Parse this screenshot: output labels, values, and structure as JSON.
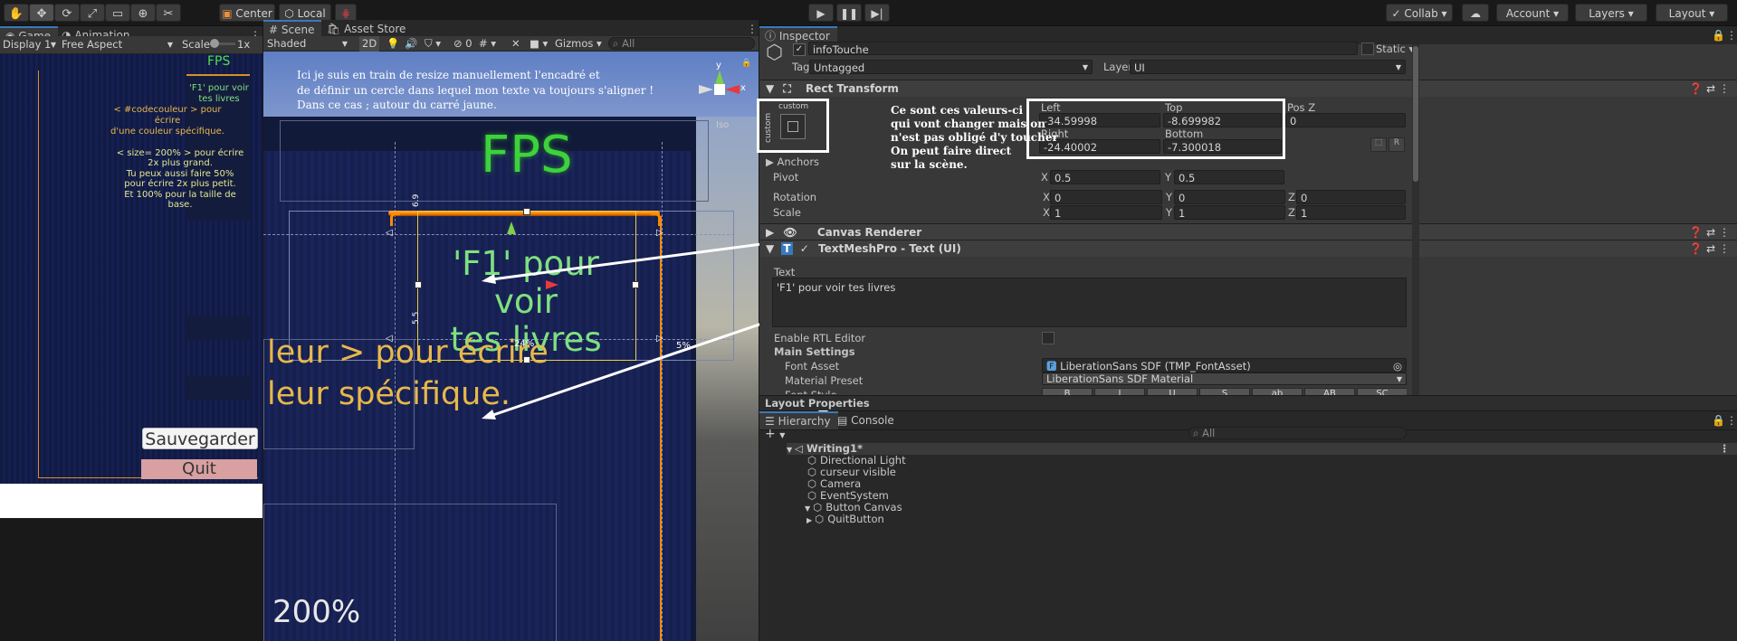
{
  "toolbar": {
    "tools": [
      "hand-tool",
      "move-tool",
      "rotate-tool",
      "scale-tool",
      "rect-tool",
      "transform-tool",
      "custom-tool"
    ],
    "pivot_label": "Center",
    "space_label": "Local",
    "collab_label": "Collab",
    "account_label": "Account",
    "layers_label": "Layers",
    "layout_label": "Layout"
  },
  "game_panel": {
    "tabs": [
      "Game",
      "Animation"
    ],
    "display": "Display 1",
    "aspect": "Free Aspect",
    "scale_label": "Scale",
    "scale_value": "1x",
    "fps": "FPS",
    "f1_text_l1": "'F1' pour voir",
    "f1_text_l2": "tes livres",
    "codecolor_l1": "< #codecouleur > pour écrire",
    "codecolor_l2": "d'une couleur spécifique.",
    "size_l1": "< size= 200% > pour écrire",
    "size_l2": "2x plus grand.",
    "size_l3": "Tu peux aussi faire 50%",
    "size_l4": "pour écrire 2x plus petit.",
    "size_l5": "Et 100% pour la taille de",
    "size_l6": "base.",
    "save_button": "Sauvegarder",
    "quit_button": "Quit"
  },
  "scene_panel": {
    "tabs": [
      "Scene",
      "Asset Store"
    ],
    "shading": "Shaded",
    "mode_2d": "2D",
    "hidden_count": "0",
    "gizmos": "Gizmos",
    "search_placeholder": "All",
    "annotation_l1": "Ici je suis en train de resize manuellement l'encadré et",
    "annotation_l2": "de définir un cercle dans lequel mon texte va toujours s'aligner !",
    "annotation_l3": "Dans ce cas ; autour du carré jaune.",
    "fps_big": "FPS",
    "f1_big_l1": "'F1' pour voir",
    "f1_big_l2": "tes livres",
    "orange_l1": "leur > pour écrire",
    "orange_l2": "leur spécifique.",
    "bottom_text": "200%",
    "pct_24": "24%",
    "pct_5": "5%",
    "pct_69": "6.9",
    "pct_55": "5.5",
    "iso": "Iso",
    "gizmo_y": "y",
    "gizmo_x": "x"
  },
  "inspector": {
    "tab": "Inspector",
    "object_name": "infoTouche",
    "static_label": "Static",
    "tag_label": "Tag",
    "tag_value": "Untagged",
    "layer_label": "Layer",
    "layer_value": "UI",
    "rect_transform": "Rect Transform",
    "anchor_preset": "custom",
    "anchor_side": "custom",
    "left_label": "Left",
    "left_value": "-34.59998",
    "top_label": "Top",
    "top_value": "-8.699982",
    "posz_label": "Pos Z",
    "posz_value": "0",
    "right_label": "Right",
    "right_value": "-24.40002",
    "bottom_label": "Bottom",
    "bottom_value": "-7.300018",
    "anchors_label": "Anchors",
    "pivot_label": "Pivot",
    "pivot_x": "0.5",
    "pivot_y": "0.5",
    "rotation_label": "Rotation",
    "rot_x": "0",
    "rot_y": "0",
    "rot_z": "0",
    "scale_label": "Scale",
    "scale_x": "1",
    "scale_y": "1",
    "scale_z": "1",
    "canvas_renderer": "Canvas Renderer",
    "tmp_text": "TextMeshPro - Text (UI)",
    "text_label": "Text",
    "text_value": "'F1' pour voir tes livres",
    "rtl_label": "Enable RTL Editor",
    "main_settings": "Main Settings",
    "font_asset_label": "Font Asset",
    "font_asset_value": "LiberationSans SDF (TMP_FontAsset)",
    "material_label": "Material Preset",
    "material_value": "LiberationSans SDF Material",
    "font_style_label": "Font Style",
    "font_style_buttons": [
      "B",
      "I",
      "U",
      "S",
      "ab",
      "AB",
      "SC"
    ],
    "layout_properties": "Layout Properties",
    "note_l1": "Ce sont ces valeurs-ci",
    "note_l2": "qui vont changer mais on",
    "note_l3": "n'est pas obligé d'y toucher",
    "note_l4": "On peut faire direct",
    "note_l5": "sur la scène."
  },
  "hierarchy": {
    "tabs": [
      "Hierarchy",
      "Console"
    ],
    "search_placeholder": "All",
    "items": [
      {
        "label": "Writing1*",
        "indent": 0,
        "kind": "scene"
      },
      {
        "label": "Directional Light",
        "indent": 1,
        "kind": "object"
      },
      {
        "label": "curseur visible",
        "indent": 1,
        "kind": "object"
      },
      {
        "label": "Camera",
        "indent": 1,
        "kind": "object"
      },
      {
        "label": "EventSystem",
        "indent": 1,
        "kind": "object"
      },
      {
        "label": "Button Canvas",
        "indent": 1,
        "kind": "object"
      },
      {
        "label": "QuitButton",
        "indent": 2,
        "kind": "object"
      }
    ]
  },
  "colors": {
    "accent": "#3a79bb",
    "fps_green": "#4ce04c",
    "text_green": "#7fe07f",
    "orange_text": "#e8b84a",
    "anchor_orange": "#ff8a00",
    "quit_pink": "#d8a0a0"
  }
}
